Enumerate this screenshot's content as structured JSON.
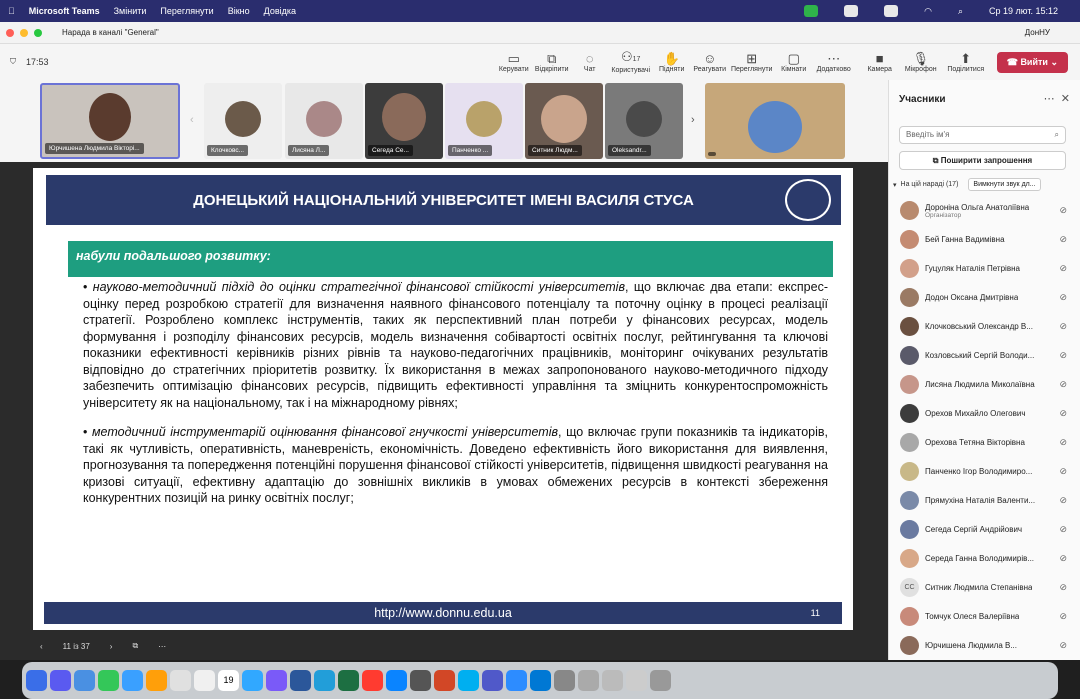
{
  "menubar": {
    "app": "Microsoft Teams",
    "items": [
      "Змінити",
      "Переглянути",
      "Вікно",
      "Довідка"
    ],
    "datetime": "Ср 19 лют.  15:12"
  },
  "window": {
    "title": "Нарада в каналі \"General\"",
    "org": "ДонНУ"
  },
  "toolbar": {
    "timer": "17:53",
    "participants_count": "17",
    "buttons": [
      "Керувати",
      "Відкріпити",
      "Чат",
      "Користувачі",
      "Підняти",
      "Реагувати",
      "Переглянути",
      "Кімнати",
      "Додатково",
      "Камера",
      "Мікрофон",
      "Поділитися"
    ],
    "leave": "Вийти"
  },
  "strip": {
    "names": [
      "Юрчишена Людмила Вікторі...",
      "Клочковс...",
      "Лисяна Л...",
      "Сегеда Се...",
      "Панченко ...",
      "Ситник Людм...",
      "Oleksandr...",
      ""
    ]
  },
  "slide": {
    "header": "ДОНЕЦЬКИЙ НАЦІОНАЛЬНИЙ УНІВЕРСИТЕТ ІМЕНІ ВАСИЛЯ СТУСА",
    "green": "набули подальшого розвитку:",
    "p1_em": "науково-методичний підхід до оцінки стратегічної фінансової стійкості університетів",
    "p1": ", що включає два етапи: експрес-оцінку перед розробкою стратегії для визначення наявного фінансового потенціалу та поточну оцінку в процесі реалізації стратегії. Розроблено комплекс інструментів, таких як перспективний план потреби у фінансових ресурсах, модель формування і розподілу фінансових ресурсів, модель визначення собівартості освітніх послуг, рейтингування та ключові показники ефективності керівників різних рівнів та науково-педагогічних працівників, моніторинг очікуваних результатів відповідно до стратегічних пріоритетів розвитку. Їх використання в межах запропонованого науково-методичного підходу забезпечить оптимізацію фінансових ресурсів, підвищить ефективності управління та зміцнить конкурентоспроможність університету як на національному, так і на міжнародному рівнях;",
    "p2_em": "методичний інструментарій оцінювання фінансової гнучкості університетів",
    "p2": ", що включає групи показників та індикаторів, такі як чутливість, оперативність, маневреність, економічність. Доведено ефективність його використання для виявлення, прогнозування та попередження потенційні порушення фінансової стійкості університетів, підвищення швидкості реагування на кризові ситуації, ефективну адаптацію до зовнішніх викликів в умовах обмежених ресурсів в контексті збереження конкурентних позицій на ринку освітніх послуг;",
    "footer": "http://www.donnu.edu.ua",
    "number": "11"
  },
  "pager": {
    "page": "11 із 37"
  },
  "panel": {
    "title": "Учасники",
    "search_placeholder": "Введіть ім'я",
    "invite": "Поширити запрошення",
    "section": "На цій нараді (17)",
    "mute_all": "Вимкнути звук дл...",
    "people": [
      {
        "name": "Дороніна Ольга Анатоліївна",
        "role": "Організатор"
      },
      {
        "name": "Бей Ганна Вадимівна"
      },
      {
        "name": "Гуцуляк Наталія Петрівна"
      },
      {
        "name": "Додон Оксана Дмитрівна"
      },
      {
        "name": "Клочковський Олександр В..."
      },
      {
        "name": "Козловський Сергій Володи..."
      },
      {
        "name": "Лисяна Людмила Миколаївна"
      },
      {
        "name": "Орехов Михайло Олегович"
      },
      {
        "name": "Орехова Тетяна Вікторівна"
      },
      {
        "name": "Панченко Ігор Володимиро..."
      },
      {
        "name": "Прямухіна Наталія Валенти..."
      },
      {
        "name": "Сегеда Сергій Андрійович"
      },
      {
        "name": "Середа Ганна Володимирів..."
      },
      {
        "name": "Ситник Людмила Степанівна",
        "initials": "СС"
      },
      {
        "name": "Томчук Олеся Валеріївна"
      },
      {
        "name": "Юрчишена Людмила В..."
      }
    ]
  },
  "dock": {
    "calendar_day": "19"
  }
}
